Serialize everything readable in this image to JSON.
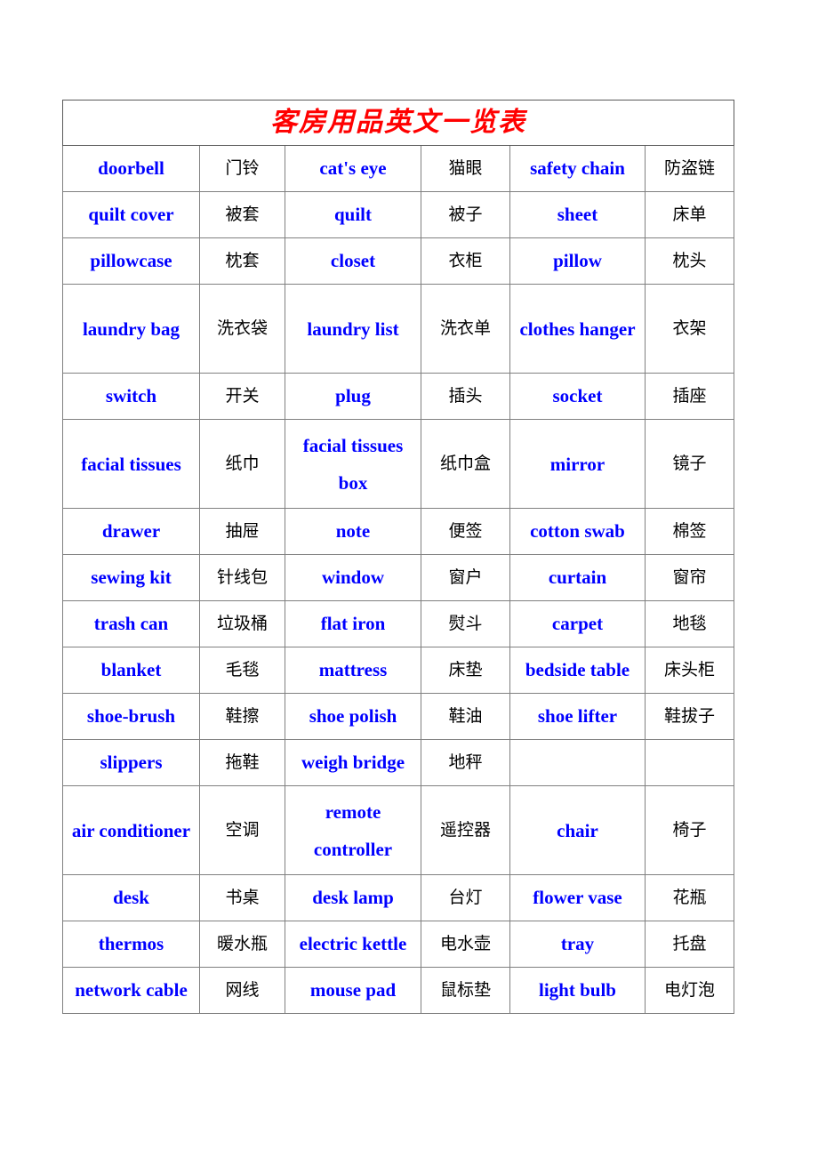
{
  "document": {
    "title": "客房用品英文一览表",
    "title_color": "#ff0000",
    "english_color": "#0000ff",
    "chinese_color": "#000000",
    "border_color": "#808080",
    "background": "#ffffff"
  },
  "table": {
    "column_count": 6,
    "row_count": 17,
    "rows": [
      {
        "tall": false,
        "cells": [
          "doorbell",
          "门铃",
          "cat's eye",
          "猫眼",
          "safety chain",
          "防盗链"
        ]
      },
      {
        "tall": false,
        "cells": [
          "quilt cover",
          "被套",
          "quilt",
          "被子",
          "sheet",
          "床单"
        ]
      },
      {
        "tall": false,
        "cells": [
          "pillowcase",
          "枕套",
          "closet",
          "衣柜",
          "pillow",
          "枕头"
        ]
      },
      {
        "tall": true,
        "cells": [
          "laundry bag",
          "洗衣袋",
          "laundry list",
          "洗衣单",
          "clothes hanger",
          "衣架"
        ]
      },
      {
        "tall": false,
        "cells": [
          "switch",
          "开关",
          "plug",
          "插头",
          "socket",
          "插座"
        ]
      },
      {
        "tall": true,
        "cells": [
          "facial tissues",
          "纸巾",
          "facial tissues box",
          "纸巾盒",
          "mirror",
          "镜子"
        ]
      },
      {
        "tall": false,
        "cells": [
          "drawer",
          "抽屉",
          "note",
          "便签",
          "cotton swab",
          "棉签"
        ]
      },
      {
        "tall": false,
        "cells": [
          "sewing kit",
          "针线包",
          "window",
          "窗户",
          "curtain",
          "窗帘"
        ]
      },
      {
        "tall": false,
        "cells": [
          "trash can",
          "垃圾桶",
          "flat iron",
          "熨斗",
          "carpet",
          "地毯"
        ]
      },
      {
        "tall": false,
        "cells": [
          "blanket",
          "毛毯",
          "mattress",
          "床垫",
          "bedside table",
          "床头柜"
        ]
      },
      {
        "tall": false,
        "cells": [
          "shoe-brush",
          "鞋擦",
          "shoe polish",
          "鞋油",
          "shoe lifter",
          "鞋拔子"
        ]
      },
      {
        "tall": false,
        "cells": [
          "slippers",
          "拖鞋",
          "weigh bridge",
          "地秤",
          "",
          ""
        ]
      },
      {
        "tall": true,
        "cells": [
          "air conditioner",
          "空调",
          "remote controller",
          "遥控器",
          "chair",
          "椅子"
        ]
      },
      {
        "tall": false,
        "cells": [
          "desk",
          "书桌",
          "desk lamp",
          "台灯",
          "flower vase",
          "花瓶"
        ]
      },
      {
        "tall": false,
        "cells": [
          "thermos",
          "暖水瓶",
          "electric kettle",
          "电水壶",
          "tray",
          "托盘"
        ]
      },
      {
        "tall": false,
        "cells": [
          "network cable",
          "网线",
          "mouse pad",
          "鼠标垫",
          "light bulb",
          "电灯泡"
        ]
      }
    ]
  }
}
